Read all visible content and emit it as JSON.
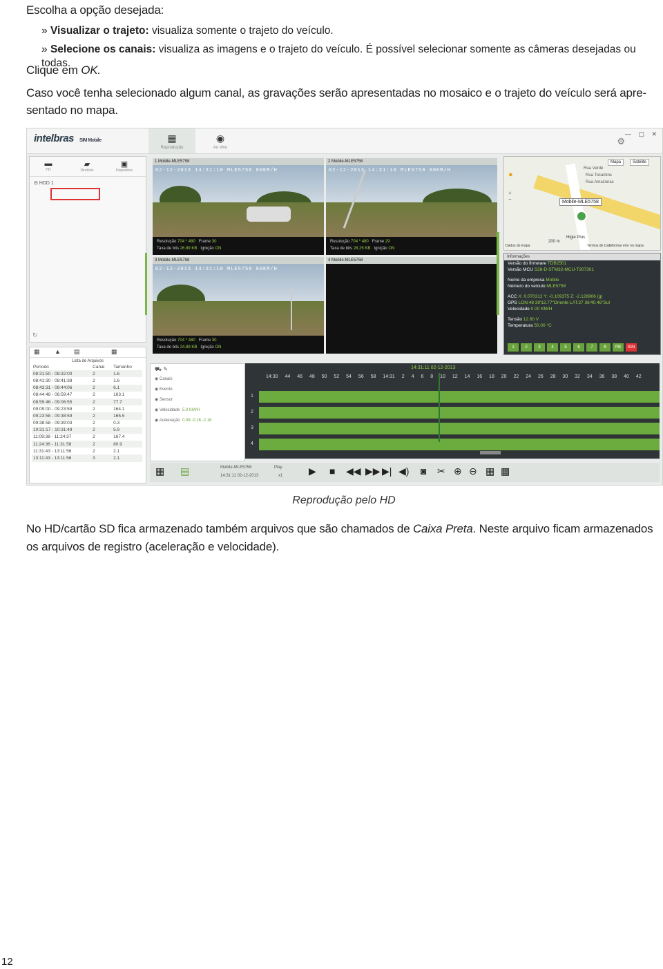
{
  "intro": "Escolha a opção desejada:",
  "bullets": [
    {
      "marker": "»",
      "strong": "Visualizar o trajeto:",
      "text": " visualiza somente o trajeto do veículo."
    },
    {
      "marker": "»",
      "strong": "Selecione os canais:",
      "text": " visualiza as imagens e o trajeto do veículo. É possível selecionar somente as câmeras desejadas ou todas."
    }
  ],
  "clique": {
    "prefix": "Clique em ",
    "ok": "OK."
  },
  "paragraph1_line1": "Caso você tenha selecionado algum canal, as gravações serão apresentadas no mosaico e o trajeto do veículo será apre-",
  "paragraph1_line2": "sentado no mapa.",
  "screenshot": {
    "logo": "intelbras",
    "logo_sub": "SIM Mobile",
    "tabs": [
      {
        "label": "Reprodução",
        "icon": "film-icon"
      },
      {
        "label": "Ao Vivo",
        "icon": "camera-icon"
      }
    ],
    "left_tabs": [
      "HD",
      "Diretório",
      "Dispositivo"
    ],
    "tree_node": "HDD 1",
    "videos": [
      {
        "title": "1 Mobile-MLE5758",
        "res": "704 * 480",
        "frame": "30",
        "bitrate": "26.89 KB",
        "ign": "ON"
      },
      {
        "title": "2 Mobile-MLE5758",
        "res": "704 * 480",
        "frame": "29",
        "bitrate": "28.25 KB",
        "ign": "ON"
      },
      {
        "title": "3 Mobile-MLE5758",
        "res": "704 * 480",
        "frame": "30",
        "bitrate": "24.89 KB",
        "ign": "ON"
      },
      {
        "title": "4 Mobile-MLE5758",
        "res": "",
        "frame": "",
        "bitrate": "",
        "ign": ""
      }
    ],
    "video_labels": {
      "res": "Resolução",
      "frame": "Frame",
      "bitrate": "Taxa de bits",
      "ign": "Ignição"
    },
    "map": {
      "btn_map": "Mapa",
      "btn_sat": "Satélite",
      "marker": "Mobile-MLE5758",
      "street1": "Rua Verde",
      "street2": "Rua Tocantins",
      "street3": "Rua Amazonas",
      "poi": "Higie Plus",
      "footer": "Dados do mapa",
      "terms": "Termos de Uso",
      "report": "Informar erro no mapa",
      "scale": "200 m"
    },
    "info": {
      "header": "Informações",
      "rows": [
        [
          "Versão do firmware",
          "TDB2501"
        ],
        [
          "Versão MCU",
          "S28-D-STM32-MCU-T307301"
        ],
        [
          "Nome da empresa",
          "Mobile"
        ],
        [
          "Número do veículo",
          "MLE5758"
        ],
        [
          "ACC",
          "X: 0.070312 Y: -0.109375 Z: -2.128906 (g)"
        ],
        [
          "GPS",
          "LON:48 39'12.77\"Oriente LAT:27 36'40.46\"Sul"
        ],
        [
          "Velocidade",
          "0.00 KM/H"
        ],
        [
          "Tensão",
          "12.60 V"
        ],
        [
          "Temperatura",
          "50.00 °C"
        ]
      ],
      "channels": [
        "1",
        "2",
        "3",
        "4",
        "5",
        "6",
        "7",
        "8",
        "PB",
        "IGN"
      ]
    },
    "files": {
      "title": "Lista de Arquivos",
      "headers": [
        "Período",
        "Canal",
        "Tamanho"
      ],
      "rows": [
        [
          "08:31:50 - 08:32:00",
          "2",
          "1.6"
        ],
        [
          "08:41:30 - 08:41:38",
          "2",
          "1.6"
        ],
        [
          "08:43:31 - 08:44:06",
          "2",
          "6.1"
        ],
        [
          "08:44:48 - 08:59:47",
          "2",
          "163.1"
        ],
        [
          "08:59:46 - 09:06:55",
          "2",
          "77.7"
        ],
        [
          "09:09:00 - 09:23:59",
          "2",
          "164.1"
        ],
        [
          "09:23:58 - 09:38:59",
          "2",
          "165.5"
        ],
        [
          "09:38:58 - 09:39:03",
          "2",
          "0.3"
        ],
        [
          "10:31:17 - 10:31:49",
          "2",
          "5.9"
        ],
        [
          "11:09:38 - 11:24:37",
          "2",
          "167.4"
        ],
        [
          "11:24:36 - 11:31:58",
          "2",
          "80.9"
        ],
        [
          "11:31:43 - 13:11:56",
          "2",
          "2.1"
        ],
        [
          "13:11:43 - 13:11:56",
          "3",
          "2.1"
        ]
      ]
    },
    "checks": {
      "items": [
        "Canais",
        "Evento",
        "Sensor",
        "Velocidade",
        "Aceleração"
      ],
      "speed": "5.0 KM/H",
      "accel": "0.09  -0.16  -2.18"
    },
    "timeline": {
      "now": "14:31:11 02-12-2013",
      "ticks": "14:30  44  46  48  50  52  54  56  58  14:31  2  4  6  8  10  12  14  16  18  20  22  24  26  28  30  32  34  36  38  40  42",
      "rows": [
        "1",
        "2",
        "3",
        "4"
      ]
    },
    "status": {
      "device": "Mobile-MLE5758",
      "state": "Play",
      "datetime": "14:31:11 02-12-2013",
      "speed": "x1"
    }
  },
  "caption": "Reprodução pelo HD",
  "paragraph2_line1_a": "No HD/cartão SD fica armazenado também arquivos que são chamados de ",
  "paragraph2_italic": "Caixa Preta",
  "paragraph2_line1_b": ". Neste arquivo ficam armazenados",
  "paragraph2_line2": "os arquivos de registro (aceleração e velocidade).",
  "page_number": "12"
}
